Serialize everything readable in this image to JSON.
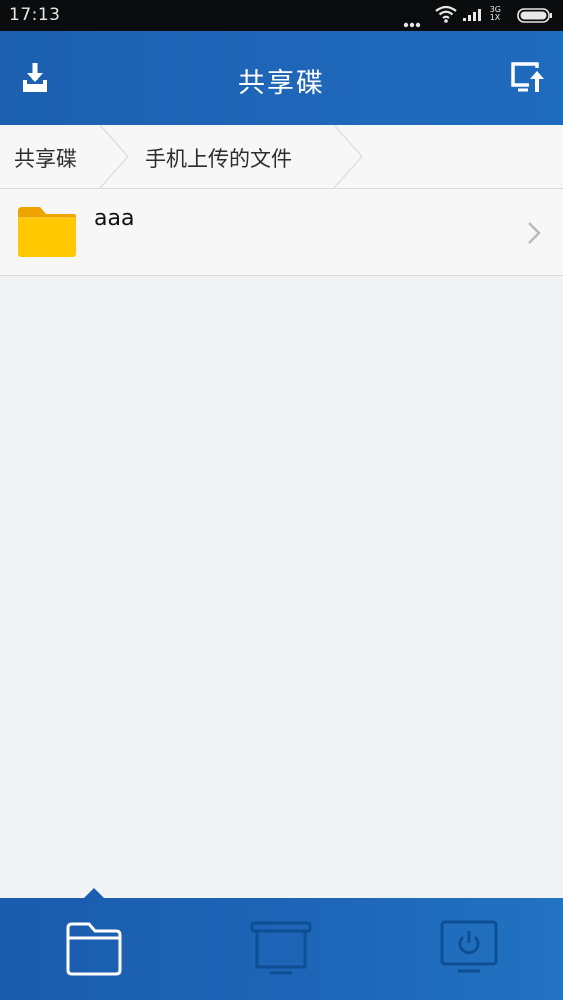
{
  "status_bar": {
    "time": "17:13",
    "network_label_top": "3G",
    "network_label_bottom": "1X"
  },
  "header": {
    "title": "共享碟",
    "left_icon": "download-icon",
    "right_icon": "upload-to-screen-icon"
  },
  "breadcrumb": {
    "items": [
      "共享碟",
      "手机上传的文件"
    ]
  },
  "files": [
    {
      "name": "aaa",
      "type": "folder"
    }
  ],
  "tab_bar": {
    "tabs": [
      {
        "icon": "folder-icon",
        "selected": true
      },
      {
        "icon": "projector-screen-icon",
        "selected": false
      },
      {
        "icon": "tv-power-icon",
        "selected": false
      }
    ]
  },
  "colors": {
    "accent": "#1f66b8",
    "folder": "#ffc800",
    "folder_tab": "#f0a400",
    "status_bar": "#0b0c0e"
  }
}
